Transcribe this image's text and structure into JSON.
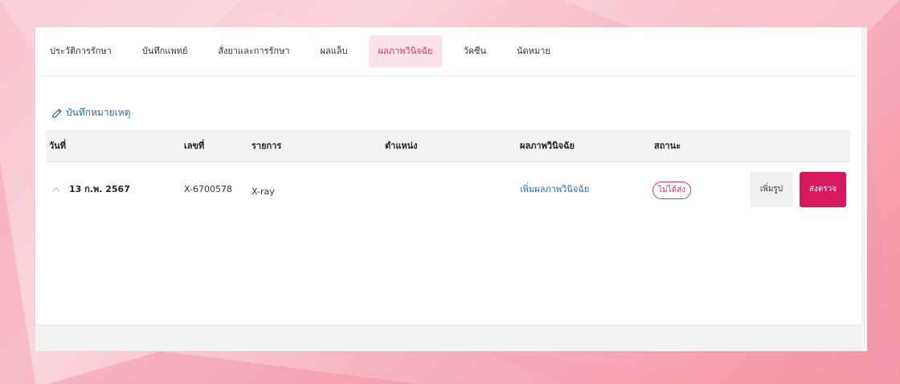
{
  "tabs": [
    {
      "label": "ประวัติการรักษา"
    },
    {
      "label": "บันทึกแพทย์"
    },
    {
      "label": "สั่งยาและการรักษา"
    },
    {
      "label": "ผลแล็บ"
    },
    {
      "label": "ผลภาพวินิจฉัย"
    },
    {
      "label": "วัคซีน"
    },
    {
      "label": "นัดหมาย"
    }
  ],
  "active_tab": "ผลภาพวินิจฉัย",
  "note_link": {
    "label": "บันทึกหมายเหตุ",
    "icon": "pencil-icon"
  },
  "table": {
    "headers": {
      "date": "วันที่",
      "number": "เลขที่",
      "item": "รายการ",
      "position": "ตำแหน่ง",
      "result": "ผลภาพวินิจฉัย",
      "status": "สถานะ"
    },
    "rows": [
      {
        "date": "13 ก.พ. 2567",
        "number": "X-6700578",
        "item": "X-ray",
        "position": "",
        "result_link": "เพิ่มผลภาพวินิจฉัย",
        "status": "ไม่ได้ส่ง",
        "image_button": "เพิ่มรูป",
        "send_button": "ส่งตรวจ"
      }
    ]
  },
  "colors": {
    "accent": "#d6195e",
    "link": "#2b6cb0",
    "active_tab_bg": "#fbe3ea"
  }
}
